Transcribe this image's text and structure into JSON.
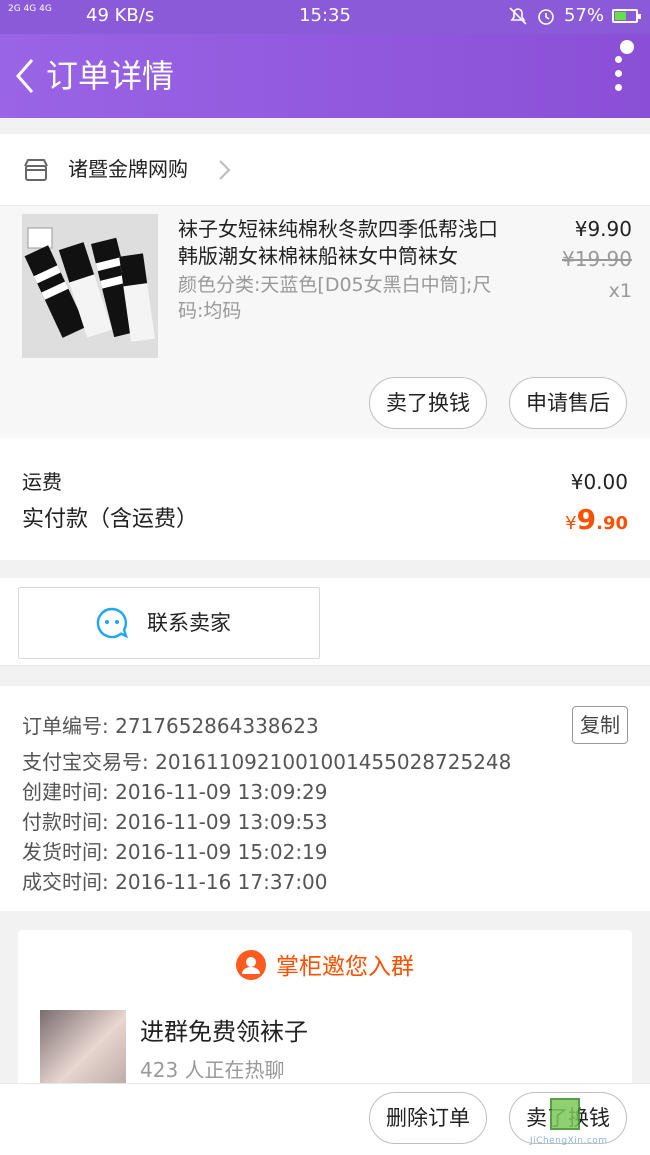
{
  "status_bar": {
    "signal": "2G 4G 4G",
    "speed": "49 KB/s",
    "time": "15:35",
    "battery": "57%",
    "battery_level": 0.57
  },
  "nav": {
    "title": "订单详情",
    "back_icon": "chevron-left-icon",
    "more_icon": "more-vertical-icon"
  },
  "shop": {
    "name": "诸暨金牌网购",
    "icon": "store-icon"
  },
  "item": {
    "title": "袜子女短袜纯棉秋冬款四季低帮浅口韩版潮女袜棉袜船袜女中筒袜女",
    "spec": "颜色分类:天蓝色[D05女黑白中筒];尺码:均码",
    "price": "¥9.90",
    "original_price": "¥19.90",
    "quantity": "x1",
    "buttons": [
      "卖了换钱",
      "申请售后"
    ]
  },
  "totals": {
    "shipping_label": "运费",
    "shipping_value": "¥0.00",
    "paid_label": "实付款（含运费）",
    "paid_currency": "¥",
    "paid_int": "9",
    "paid_dec": ".90",
    "accent": "#ff5000"
  },
  "contact": {
    "label": "联系卖家"
  },
  "order_info": {
    "order_no": "订单编号: 2717652864338623",
    "alipay_no": "支付宝交易号: 2016110921001001455028725248",
    "created": "创建时间: 2016-11-09 13:09:29",
    "paid": "付款时间: 2016-11-09 13:09:53",
    "shipped": "发货时间: 2016-11-09 15:02:19",
    "completed": "成交时间: 2016-11-16 17:37:00",
    "copy_label": "复制"
  },
  "group": {
    "header": "掌柜邀您入群",
    "title": "进群免费领袜子",
    "subtitle": "423 人正在热聊"
  },
  "bottom_bar": {
    "buttons": [
      "删除订单",
      "卖了换钱"
    ]
  },
  "colors": {
    "nav": "#8a4fd6",
    "accent": "#ff5000"
  }
}
